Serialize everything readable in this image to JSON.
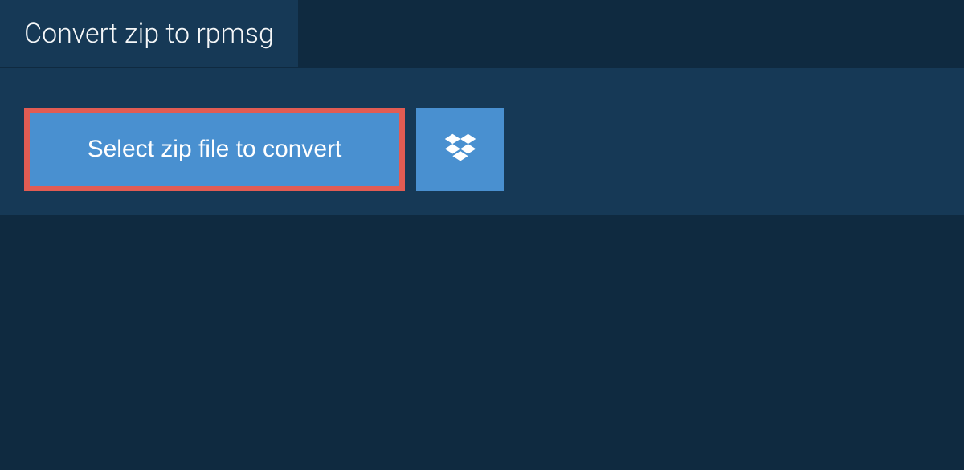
{
  "header": {
    "tab_label": "Convert zip to rpmsg"
  },
  "actions": {
    "select_file_label": "Select zip file to convert",
    "dropbox_icon": "dropbox-icon"
  },
  "colors": {
    "background": "#0f2a40",
    "panel": "#163956",
    "button": "#4990d0",
    "highlight_border": "#e25c53"
  }
}
